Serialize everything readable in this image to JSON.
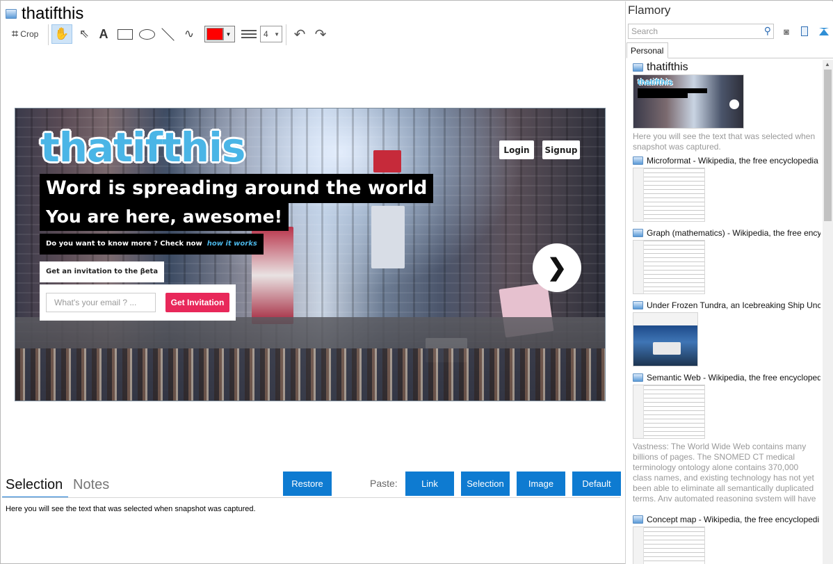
{
  "window": {
    "title": "thatifthis"
  },
  "toolbar": {
    "crop_label": "Crop",
    "text_tool_glyph": "A",
    "selected_color": "#ff0000",
    "line_width": "4",
    "icons": [
      "crop-icon",
      "hand-icon",
      "pointer-icon",
      "text-icon",
      "rectangle-icon",
      "ellipse-icon",
      "line-icon",
      "freehand-icon",
      "color-picker",
      "line-width-icon",
      "undo-icon",
      "redo-icon"
    ]
  },
  "snapshot": {
    "logo": "thatifthis",
    "headline1": "Word is spreading around the world",
    "headline2": "You are here, awesome!",
    "question": "Do you want to know more ?  Check now",
    "question_link": "how it works",
    "login": "Login",
    "signup": "Signup",
    "invite_label": "Get an invitation to the βeta",
    "email_placeholder": "What's your email ? ...",
    "invite_button": "Get Invitation",
    "next_arrow": "❯"
  },
  "bottom": {
    "tab_selection": "Selection",
    "tab_notes": "Notes",
    "restore": "Restore",
    "paste_label": "Paste:",
    "paste_link": "Link",
    "paste_selection": "Selection",
    "paste_image": "Image",
    "paste_default": "Default",
    "selection_text": "Here you will see the text that was selected when snapshot was captured."
  },
  "sidebar": {
    "app_name": "Flamory",
    "search_placeholder": "Search",
    "tab": "Personal",
    "items": [
      {
        "title": "thatifthis",
        "desc": "Here you will see the text that was selected when snapshot was captured."
      },
      {
        "title": "Microformat - Wikipedia, the free encyclopedia"
      },
      {
        "title": "Graph (mathematics) - Wikipedia, the free ency"
      },
      {
        "title": "Under Frozen Tundra, an Icebreaking Ship Unco"
      },
      {
        "title": "Semantic Web - Wikipedia, the free encycloped",
        "desc": "Vastness: The World Wide Web contains many billions of pages. The SNOMED CT medical terminology ontology alone contains 370,000 class names, and existing technology has not yet been able to eliminate all semantically duplicated terms. Any automated reasoning system will have to deal with truly huge inputs."
      },
      {
        "title": "Concept map - Wikipedia, the free encyclopedi"
      }
    ]
  },
  "colors": {
    "accent": "#0e7bd1",
    "tab_underline": "#1478d4",
    "invite_button": "#e8285a",
    "logo": "#4ab5e6"
  }
}
